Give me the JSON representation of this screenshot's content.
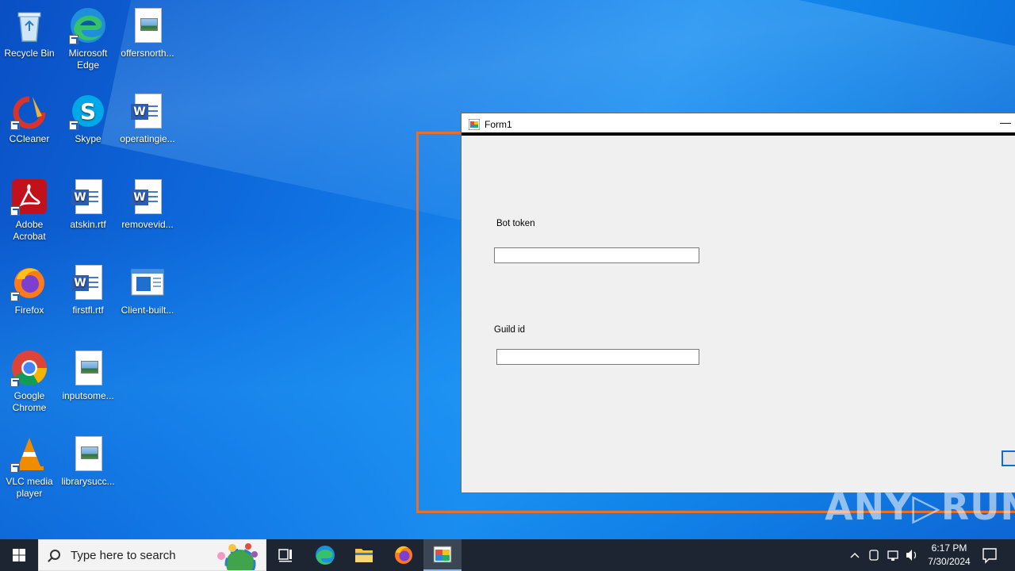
{
  "desktop": {
    "icons": [
      {
        "label": "Recycle Bin"
      },
      {
        "label": "Microsoft Edge"
      },
      {
        "label": "offersnorth..."
      },
      {
        "label": "CCleaner"
      },
      {
        "label": "Skype"
      },
      {
        "label": "operatingie..."
      },
      {
        "label": "Adobe Acrobat"
      },
      {
        "label": "atskin.rtf"
      },
      {
        "label": "removevid..."
      },
      {
        "label": "Firefox"
      },
      {
        "label": "firstfl.rtf"
      },
      {
        "label": "Client-built..."
      },
      {
        "label": "Google Chrome"
      },
      {
        "label": "inputsome..."
      },
      {
        "label": "VLC media player"
      },
      {
        "label": "librarysucc..."
      }
    ]
  },
  "form": {
    "title": "Form1",
    "minimize_glyph": "—",
    "bot_token_label": "Bot token",
    "bot_token_value": "",
    "guild_id_label": "Guild id",
    "guild_id_value": ""
  },
  "watermark": "ANY▷RUN",
  "taskbar": {
    "search_placeholder": "Type here to search",
    "time": "6:17 PM",
    "date": "7/30/2024"
  },
  "colors": {
    "highlight": "#e8702a",
    "taskbar": "#1c2531"
  }
}
